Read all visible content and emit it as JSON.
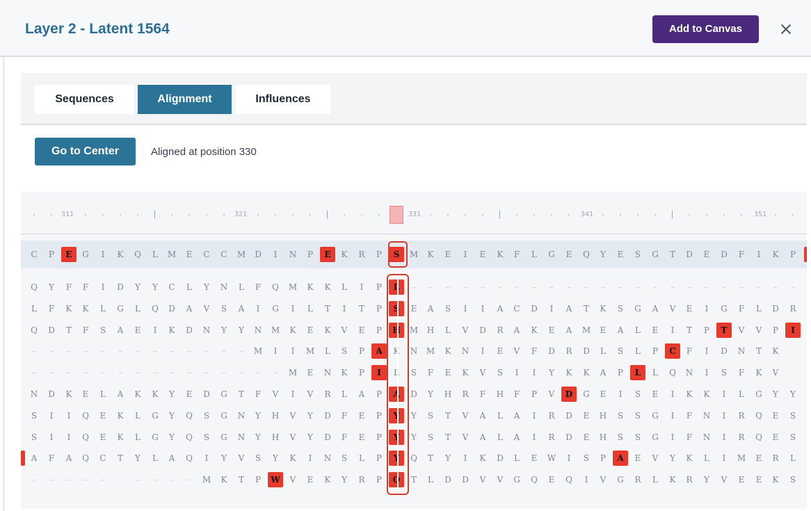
{
  "header": {
    "title": "Layer 2 - Latent 1564",
    "add_button": "Add to Canvas",
    "close_label": "×"
  },
  "tabs": [
    {
      "label": "Sequences",
      "active": false
    },
    {
      "label": "Alignment",
      "active": true
    },
    {
      "label": "Influences",
      "active": false
    }
  ],
  "toolbar": {
    "center_button": "Go to Center",
    "aligned_text": "Aligned at position 330"
  },
  "ruler": {
    "labels": [
      "311",
      "321",
      "331",
      "341",
      "351"
    ]
  },
  "alignment": {
    "reference": "CPEGIKQLMECCMDINPEKRPSMKEIEKFLGEQYESGTDEDFIKP",
    "reference_highlights": [
      2,
      17,
      21
    ],
    "rows": [
      {
        "seq": "QYFFIDYYCLYNLFQMKKLIPL-----------------------",
        "highlights": [
          21
        ]
      },
      {
        "seq": "LFKKLGLQDAVSAIGILTITPSEASIIACDIATKSGAVEIGFLDR",
        "highlights": [
          21
        ]
      },
      {
        "seq": "QDTFSAEIKDNYYNMKEKVEPHMHLVDRAKEAMEALEITPTVVPI",
        "highlights": [
          21,
          40,
          44
        ]
      },
      {
        "seq": "-------------MIIMLSPAKNMKNIEVFDRDLSLPCFIDNTK",
        "highlights": [
          20,
          37
        ]
      },
      {
        "seq": "---------------MENKPILSFEKVSIIYKKAPLLQNISFKV",
        "highlights": [
          20,
          35
        ]
      },
      {
        "seq": "NDKELAKKYEDGTFVIVRLAPADYHRFHFPVDGEISEIKKILGYY",
        "highlights": [
          21,
          31
        ]
      },
      {
        "seq": "SIIQEKLGYQSGNYHVYDFEPYYSTVALAIRDEHSSGIFNIRQES",
        "highlights": [
          21
        ]
      },
      {
        "seq": "SIIQEKLGYQSGNYHVYDFEPYYSTVALAIRDEHSSGIFNIRQES",
        "highlights": [
          21
        ]
      },
      {
        "seq": "AFAQCTYLAQIYVSYKINSLPYQTYIKDLEWISPAEVYKLIMERL",
        "highlights": [
          21,
          34
        ]
      },
      {
        "seq": "----------MKTPWVEKYRPQTLDDVVGQEQIVGRLKRYVEEKS",
        "highlights": [
          14,
          21
        ]
      }
    ]
  }
}
